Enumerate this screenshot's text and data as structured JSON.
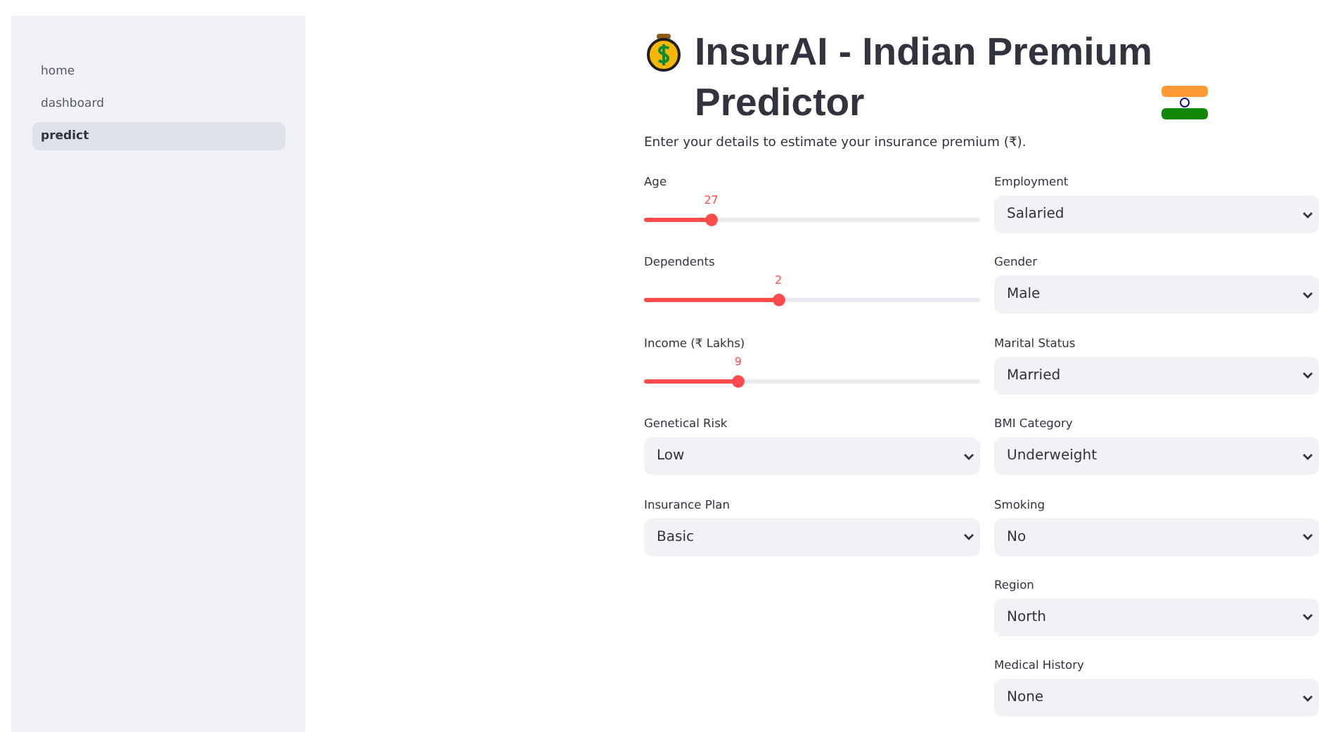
{
  "sidebar": {
    "items": [
      {
        "label": "home",
        "selected": false
      },
      {
        "label": "dashboard",
        "selected": false
      },
      {
        "label": "predict",
        "selected": true
      }
    ]
  },
  "header": {
    "title": "InsurAI - Indian Premium Predictor",
    "description": "Enter your details to estimate your insurance premium (₹)."
  },
  "form": {
    "left": [
      {
        "kind": "slider",
        "label": "Age",
        "reading": "27",
        "level": 0.2
      },
      {
        "kind": "slider",
        "label": "Dependents",
        "reading": "2",
        "level": 0.4
      },
      {
        "kind": "slider",
        "label": "Income (₹ Lakhs)",
        "reading": "9",
        "level": 0.28
      },
      {
        "kind": "select",
        "label": "Genetical Risk",
        "value": "Low"
      },
      {
        "kind": "select",
        "label": "Insurance Plan",
        "value": "Basic"
      }
    ],
    "right": [
      {
        "kind": "select",
        "label": "Employment",
        "value": "Salaried"
      },
      {
        "kind": "select",
        "label": "Gender",
        "value": "Male"
      },
      {
        "kind": "select",
        "label": "Marital Status",
        "value": "Married"
      },
      {
        "kind": "select",
        "label": "BMI Category",
        "value": "Underweight"
      },
      {
        "kind": "select",
        "label": "Smoking",
        "value": "No"
      },
      {
        "kind": "select",
        "label": "Region",
        "value": "North"
      },
      {
        "kind": "select",
        "label": "Medical History",
        "value": "None"
      }
    ]
  }
}
